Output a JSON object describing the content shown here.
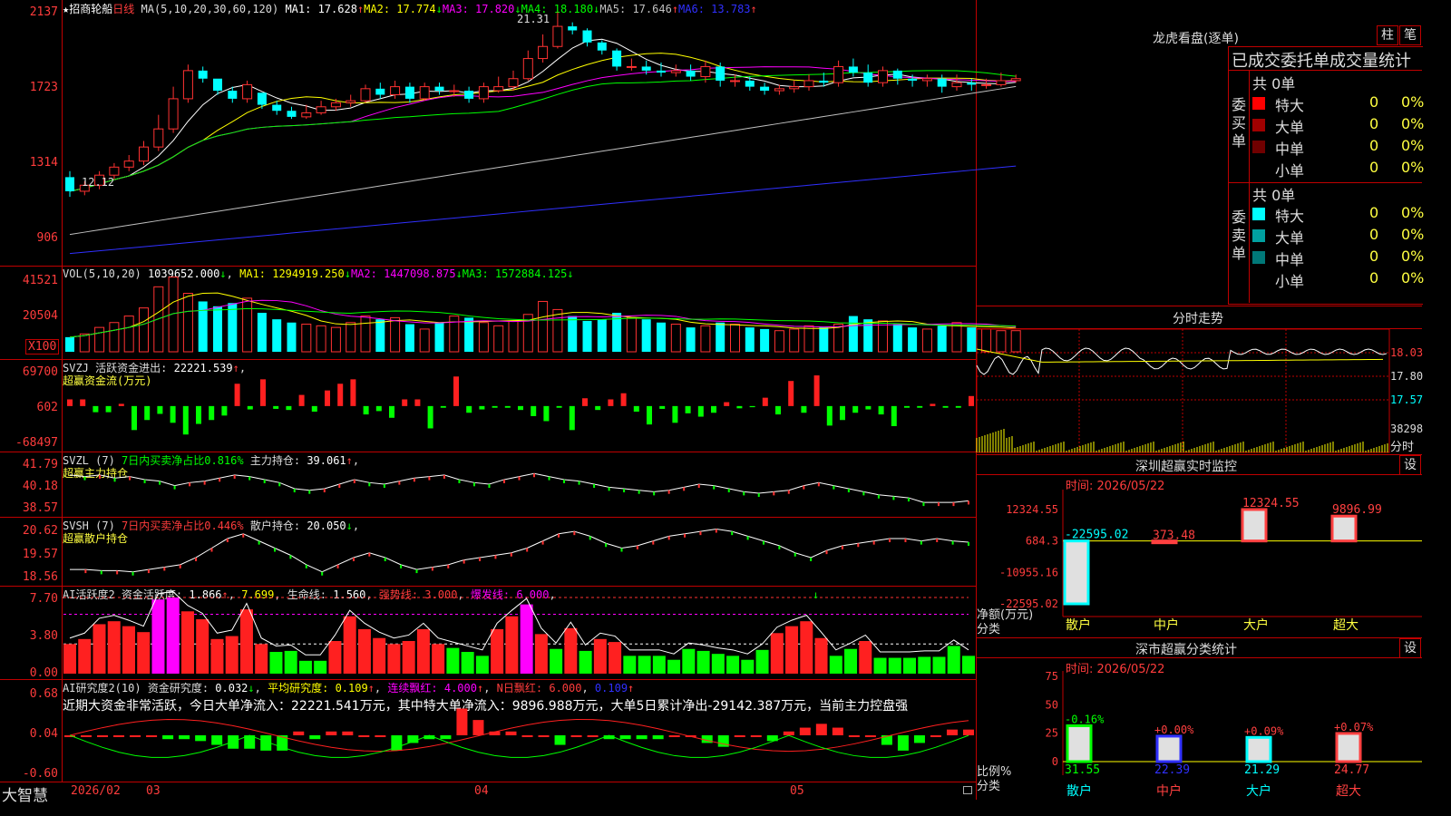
{
  "stock": {
    "name": "招商轮船",
    "period": "日线",
    "star": "★"
  },
  "main_chart": {
    "ma_label": "MA(5,10,20,30,60,120)",
    "ma": [
      {
        "name": "MA1",
        "value": "17.628",
        "arrow": "↑",
        "color": "#ffffff"
      },
      {
        "name": "MA2",
        "value": "17.774",
        "arrow": "↓",
        "color": "#ffff00"
      },
      {
        "name": "MA3",
        "value": "17.820",
        "arrow": "↓",
        "color": "#ff00ff"
      },
      {
        "name": "MA4",
        "value": "18.180",
        "arrow": "↓",
        "color": "#00ff00"
      },
      {
        "name": "MA5",
        "value": "17.646",
        "arrow": "↑",
        "color": "#c0c0c0"
      },
      {
        "name": "MA6",
        "value": "13.783",
        "arrow": "↑",
        "color": "#3030ff"
      }
    ],
    "y_ticks": [
      "2137",
      "1723",
      "1314",
      "906"
    ],
    "high_label": "21.31",
    "low_label": "12.12"
  },
  "vol": {
    "label": "VOL(5,10,20)",
    "value": "1039652.000",
    "arrow": "↓",
    "ma": [
      {
        "name": "MA1",
        "value": "1294919.250",
        "arrow": "↓",
        "color": "#ffff00"
      },
      {
        "name": "MA2",
        "value": "1447098.875",
        "arrow": "↓",
        "color": "#ff00ff"
      },
      {
        "name": "MA3",
        "value": "1572884.125",
        "arrow": "↓",
        "color": "#00ff00"
      }
    ],
    "y_ticks": [
      "41521",
      "20504"
    ],
    "unit": "X100"
  },
  "svzj": {
    "label": "SVZJ",
    "text": "活跃资金进出:",
    "value": "22221.539",
    "arrow": "↑",
    "sub": "超赢资金流(万元)",
    "y_ticks": [
      "69700",
      "602",
      "-68497"
    ]
  },
  "svzl": {
    "label": "SVZL (7)",
    "text1": "7日内买卖净占比0.816%",
    "text2": "主力持仓:",
    "value": "39.061",
    "arrow": "↑",
    "sub": "超赢主力持仓",
    "y_ticks": [
      "41.79",
      "40.18",
      "38.57"
    ]
  },
  "svsh": {
    "label": "SVSH (7)",
    "text1": "7日内买卖净占比0.446%",
    "text2": "散户持仓:",
    "value": "20.050",
    "arrow": "↓",
    "sub": "超赢散户持仓",
    "y_ticks": [
      "20.62",
      "19.57",
      "18.56"
    ]
  },
  "ai_active": {
    "label": "AI活跃度2",
    "t1": "资金活跃度:",
    "v1": "1.866",
    "a1": "↑",
    "v2": "7.699",
    "t3": "生命线:",
    "v3": "1.560",
    "t4": "强势线:",
    "v4": "3.000",
    "t5": "爆发线:",
    "v5": "6.000",
    "y_ticks": [
      "7.70",
      "3.80",
      "0.00"
    ]
  },
  "ai_research": {
    "label": "AI研究度2(10)",
    "t1": "资金研究度:",
    "v1": "0.032",
    "a1": "↓",
    "t2": "平均研究度:",
    "v2": "0.109",
    "a2": "↑",
    "t3": "连续飘红:",
    "v3": "4.000",
    "a3": "↑",
    "t4": "N日飘红:",
    "v4": "6.000",
    "v5": "0.109",
    "a5": "↑",
    "summary": "近期大资金非常活跃，今日大单净流入：22221.541万元，其中特大单净流入：9896.988万元，大单5日累计净出-29142.387万元，当前主力控盘强",
    "y_ticks": [
      "0.68",
      "0.04",
      "-0.60"
    ]
  },
  "time_axis": {
    "labels": [
      "2026/02",
      "03",
      "04",
      "05"
    ],
    "logo": "大智慧"
  },
  "right_panel": {
    "lhb_title": "龙虎看盘(逐单)",
    "btn_zhu": "柱",
    "btn_bi": "笔",
    "order_header": "已成交委托单成交量统计",
    "buy_label": "委买单",
    "sell_label": "委卖单",
    "buy_total": "共 0单",
    "sell_total": "共 0单",
    "buy_rows": [
      {
        "name": "特大",
        "count": "0",
        "pct": "0%",
        "color": "#ff0000"
      },
      {
        "name": "大单",
        "count": "0",
        "pct": "0%",
        "color": "#a00000"
      },
      {
        "name": "中单",
        "count": "0",
        "pct": "0%",
        "color": "#700000"
      },
      {
        "name": "小单",
        "count": "0",
        "pct": "0%",
        "color": ""
      }
    ],
    "sell_rows": [
      {
        "name": "特大",
        "count": "0",
        "pct": "0%",
        "color": "#00ffff"
      },
      {
        "name": "大单",
        "count": "0",
        "pct": "0%",
        "color": "#00a0a0"
      },
      {
        "name": "中单",
        "count": "0",
        "pct": "0%",
        "color": "#007878"
      },
      {
        "name": "小单",
        "count": "0",
        "pct": "0%",
        "color": ""
      }
    ],
    "intraday_title": "分时走势",
    "intraday_prices": [
      "18.03",
      "17.80",
      "17.57"
    ],
    "intraday_vol": "38298",
    "intraday_vol_label": "分时",
    "sz_monitor": {
      "title": "深圳超赢实时监控",
      "btn": "设",
      "time": "时间: 2026/05/22",
      "y_ticks": [
        "12324.55",
        "684.3",
        "-10955.16",
        "-22595.02"
      ],
      "axis_label": "净额(万元)",
      "axis_label2": "分类",
      "bars": [
        {
          "name": "散户",
          "value": -22595.02,
          "label": "-22595.02",
          "color": "#00ffff",
          "label_color": "#00ffff"
        },
        {
          "name": "中户",
          "value": 373.48,
          "label": "373.48",
          "color": "#ff4040",
          "label_color": "#ff4040"
        },
        {
          "name": "大户",
          "value": 12324.55,
          "label": "12324.55",
          "color": "#ff4040",
          "label_color": "#ff4040"
        },
        {
          "name": "超大",
          "value": 9896.99,
          "label": "9896.99",
          "color": "#ff4040",
          "label_color": "#ff4040"
        }
      ]
    },
    "sz_class": {
      "title": "深市超赢分类统计",
      "btn": "设",
      "time": "时间: 2026/05/22",
      "y_ticks": [
        "75",
        "50",
        "25",
        "0"
      ],
      "axis_label": "比例%",
      "axis_label2": "分类",
      "bars": [
        {
          "name": "散户",
          "value": 31.55,
          "label": "31.55",
          "change": "-0.16%",
          "color": "#00ff00",
          "change_color": "#00ff00"
        },
        {
          "name": "中户",
          "value": 22.39,
          "label": "22.39",
          "change": "+0.00%",
          "color": "#3030ff",
          "change_color": "#ff4040"
        },
        {
          "name": "大户",
          "value": 21.29,
          "label": "21.29",
          "change": "+0.09%",
          "color": "#00ffff",
          "change_color": "#ff4040"
        },
        {
          "name": "超大",
          "value": 24.77,
          "label": "24.77",
          "change": "+0.07%",
          "color": "#ff4040",
          "change_color": "#ff4040"
        }
      ]
    }
  },
  "chart_data": [
    {
      "type": "candlestick",
      "title": "招商轮船 日线",
      "ylim": [
        9.06,
        21.37
      ],
      "open": [
        13.1,
        12.4,
        12.7,
        13.2,
        13.6,
        13.9,
        14.6,
        15.5,
        17.0,
        18.4,
        18.0,
        17.4,
        17.0,
        17.3,
        16.7,
        16.4,
        16.1,
        16.3,
        16.6,
        16.8,
        16.9,
        17.5,
        17.2,
        17.6,
        17.0,
        17.6,
        17.4,
        17.4,
        17.0,
        17.4,
        17.6,
        18.0,
        19.0,
        19.6,
        20.6,
        20.4,
        19.8,
        19.4,
        18.6,
        18.6,
        18.4,
        18.3,
        18.4,
        18.1,
        18.6,
        17.9,
        17.9,
        17.6,
        17.4,
        17.5,
        17.6,
        17.9,
        17.8,
        18.6,
        18.3,
        17.8,
        18.4,
        18.0,
        17.9,
        18.0,
        17.6,
        17.8,
        17.7,
        17.7,
        17.9
      ],
      "close": [
        12.4,
        12.7,
        13.2,
        13.6,
        13.9,
        14.6,
        15.5,
        17.0,
        18.4,
        18.0,
        17.4,
        17.0,
        17.7,
        16.7,
        16.4,
        16.1,
        16.3,
        16.6,
        16.8,
        16.9,
        17.5,
        17.2,
        17.6,
        17.0,
        17.6,
        17.4,
        17.4,
        17.0,
        17.6,
        17.6,
        18.0,
        19.0,
        19.6,
        20.6,
        20.4,
        19.8,
        19.4,
        18.6,
        18.6,
        18.4,
        18.3,
        18.4,
        18.1,
        18.6,
        17.9,
        17.9,
        17.6,
        17.4,
        17.5,
        17.6,
        17.9,
        17.8,
        18.6,
        18.3,
        17.8,
        18.4,
        18.0,
        17.9,
        18.0,
        17.6,
        17.8,
        17.7,
        17.7,
        17.9,
        18.0
      ],
      "high": [
        13.4,
        12.9,
        13.4,
        13.8,
        14.2,
        14.9,
        16.2,
        17.6,
        18.7,
        18.6,
        17.9,
        17.6,
        17.9,
        17.1,
        16.9,
        16.6,
        16.7,
        16.9,
        17.0,
        17.2,
        17.7,
        17.8,
        17.9,
        17.8,
        17.8,
        17.8,
        17.7,
        17.6,
        17.8,
        18.1,
        18.4,
        19.4,
        20.2,
        21.31,
        20.8,
        20.5,
        19.9,
        19.5,
        19.0,
        18.9,
        18.8,
        18.7,
        18.7,
        18.9,
        18.8,
        18.2,
        18.1,
        17.8,
        17.7,
        17.9,
        18.2,
        18.3,
        18.9,
        19.0,
        18.7,
        18.6,
        18.5,
        18.2,
        18.2,
        18.2,
        18.2,
        18.0,
        18.0,
        18.3,
        18.2
      ],
      "low": [
        12.12,
        12.2,
        12.5,
        13.0,
        13.4,
        13.7,
        14.4,
        15.3,
        16.8,
        17.8,
        17.2,
        16.8,
        16.8,
        16.5,
        16.2,
        16.0,
        16.0,
        16.2,
        16.4,
        16.6,
        16.8,
        17.0,
        17.0,
        16.8,
        16.9,
        17.2,
        17.1,
        16.8,
        16.8,
        17.3,
        17.4,
        17.9,
        18.8,
        19.5,
        20.2,
        19.6,
        19.2,
        18.4,
        18.4,
        18.2,
        18.1,
        18.1,
        17.9,
        17.8,
        17.6,
        17.6,
        17.4,
        17.2,
        17.2,
        17.3,
        17.4,
        17.6,
        17.6,
        18.1,
        17.6,
        17.6,
        17.7,
        17.6,
        17.6,
        17.3,
        17.4,
        17.4,
        17.5,
        17.6,
        17.8
      ]
    },
    {
      "type": "bar",
      "title": "VOL(5,10,20)",
      "ylim": [
        0,
        48000
      ],
      "values": [
        9000,
        11000,
        15000,
        18000,
        22000,
        27000,
        40000,
        46000,
        36000,
        31000,
        28000,
        30000,
        33000,
        24000,
        20000,
        18000,
        17000,
        16000,
        15000,
        18000,
        22000,
        20000,
        21000,
        17000,
        14000,
        18000,
        22000,
        21000,
        18000,
        16000,
        19000,
        23000,
        31000,
        26000,
        22000,
        19000,
        20000,
        24000,
        21000,
        20000,
        18000,
        17000,
        15000,
        16000,
        18000,
        17000,
        15000,
        14000,
        13000,
        14000,
        16000,
        15000,
        17000,
        22000,
        20000,
        19000,
        17000,
        15000,
        14000,
        16000,
        18000,
        15000,
        14000,
        13000,
        13000
      ]
    },
    {
      "type": "bar",
      "title": "SVZJ 超赢资金流(万元)",
      "ylim": [
        -68497,
        69700
      ],
      "values": [
        12000,
        12000,
        -11000,
        -11000,
        4000,
        -43000,
        -25000,
        -14000,
        -30000,
        -51000,
        -32000,
        -25000,
        -17000,
        40000,
        -6000,
        48000,
        -5000,
        -7000,
        20000,
        -10000,
        28000,
        40000,
        48000,
        -15000,
        -9000,
        -21000,
        12000,
        12000,
        -40000,
        -3000,
        53000,
        -12000,
        -6000,
        -3000,
        -3000,
        -7000,
        -18000,
        -27000,
        -3000,
        -43000,
        14000,
        -7000,
        12000,
        23000,
        -10000,
        -33000,
        -5000,
        -30000,
        -13000,
        -19000,
        -12000,
        7000,
        -4000,
        -2000,
        15000,
        -15000,
        45000,
        -12000,
        55000,
        -35000,
        -25000,
        -12000,
        -6000,
        -15000,
        -36000,
        -3000,
        -3000,
        4000,
        -3000,
        -3000,
        18000
      ]
    },
    {
      "type": "line",
      "title": "SVZL 超赢主力持仓",
      "ylim": [
        38.57,
        41.79
      ],
      "values": [
        40.9,
        40.8,
        40.9,
        40.7,
        40.8,
        40.6,
        40.5,
        40.2,
        40.4,
        40.5,
        40.7,
        40.9,
        40.8,
        40.6,
        40.4,
        40.0,
        39.9,
        40.0,
        40.3,
        40.6,
        40.4,
        40.3,
        40.5,
        40.7,
        40.8,
        40.9,
        40.6,
        40.4,
        40.3,
        40.6,
        40.8,
        41.0,
        40.8,
        40.6,
        40.5,
        40.3,
        40.1,
        40.0,
        39.9,
        39.8,
        39.9,
        40.1,
        40.3,
        40.2,
        40.0,
        39.8,
        39.7,
        39.8,
        39.9,
        40.2,
        40.4,
        40.2,
        40.0,
        39.8,
        39.6,
        39.5,
        39.4,
        39.1,
        39.1,
        39.1,
        39.2
      ]
    },
    {
      "type": "line",
      "title": "SVSH 超赢散户持仓",
      "ylim": [
        18.56,
        20.62
      ],
      "values": [
        18.9,
        18.9,
        18.85,
        18.85,
        18.8,
        18.9,
        19.0,
        19.1,
        19.4,
        19.8,
        20.2,
        20.4,
        20.1,
        19.8,
        19.5,
        19.1,
        18.8,
        19.1,
        19.4,
        19.6,
        19.4,
        19.1,
        18.9,
        19.0,
        19.1,
        19.3,
        19.4,
        19.5,
        19.6,
        19.8,
        20.1,
        20.4,
        20.5,
        20.3,
        20.0,
        19.8,
        19.9,
        20.1,
        20.3,
        20.4,
        20.5,
        20.6,
        20.5,
        20.3,
        20.1,
        19.9,
        19.6,
        19.4,
        19.7,
        19.9,
        20.0,
        20.1,
        20.2,
        20.2,
        20.1,
        20.2,
        20.1,
        20.05
      ]
    },
    {
      "type": "bar",
      "title": "AI活跃度2",
      "ylim": [
        0,
        7.7
      ],
      "values": [
        3.0,
        3.5,
        5.0,
        5.3,
        4.8,
        4.2,
        7.5,
        7.7,
        6.3,
        5.5,
        3.5,
        3.8,
        6.5,
        3.0,
        2.2,
        2.3,
        1.3,
        1.3,
        3.3,
        5.8,
        4.5,
        3.6,
        3.0,
        3.3,
        4.5,
        3.0,
        2.6,
        2.2,
        1.8,
        4.5,
        5.8,
        7.0,
        4.0,
        2.5,
        4.6,
        2.3,
        3.5,
        3.2,
        1.8,
        1.8,
        1.8,
        1.4,
        2.5,
        2.3,
        2.0,
        1.8,
        1.4,
        2.4,
        4.1,
        4.8,
        5.3,
        3.6,
        1.8,
        2.5,
        3.3,
        1.6,
        1.6,
        1.6,
        1.7,
        1.7,
        2.8,
        1.8
      ]
    },
    {
      "type": "bar",
      "title": "AI研究度2(10)",
      "ylim": [
        -0.6,
        0.68
      ],
      "values": [
        0.0,
        0.0,
        0.0,
        0.0,
        0.0,
        0.0,
        -0.02,
        -0.02,
        -0.03,
        -0.05,
        -0.07,
        -0.07,
        -0.08,
        -0.08,
        0.02,
        -0.02,
        0.02,
        0.02,
        0.0,
        0.0,
        -0.08,
        -0.04,
        -0.02,
        -0.02,
        0.14,
        0.08,
        0.02,
        0.02,
        0.0,
        0.0,
        -0.05,
        0.0,
        0.0,
        -0.02,
        -0.02,
        -0.02,
        -0.02,
        0.0,
        0.0,
        -0.04,
        -0.06,
        0.0,
        0.0,
        -0.03,
        0.02,
        0.04,
        0.06,
        0.04,
        0.0,
        0.0,
        -0.05,
        -0.08,
        -0.04,
        0.0,
        0.03,
        0.03
      ]
    }
  ]
}
